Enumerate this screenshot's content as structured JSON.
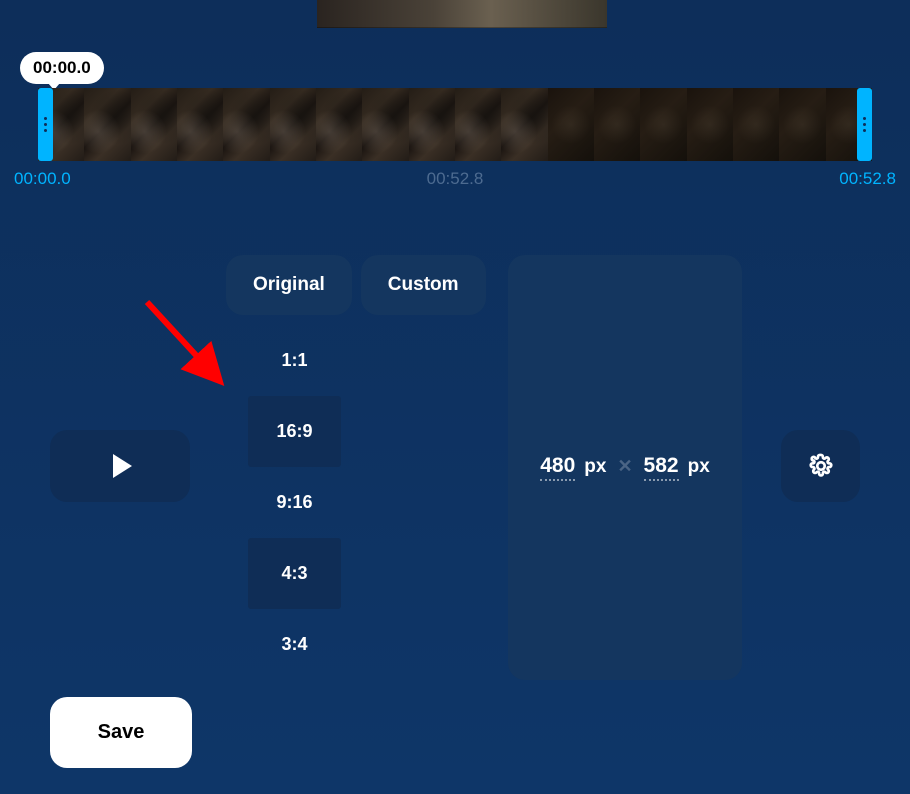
{
  "timeline": {
    "playhead_label": "00:00.0",
    "start_label": "00:00.0",
    "mid_label": "00:52.8",
    "end_label": "00:52.8"
  },
  "tabs": {
    "original": "Original",
    "custom": "Custom"
  },
  "ratios": [
    "1:1",
    "16:9",
    "9:16",
    "4:3",
    "3:4"
  ],
  "dimensions": {
    "width": "480",
    "height": "582",
    "unit": "px",
    "separator": "✕"
  },
  "buttons": {
    "save": "Save"
  },
  "icons": {
    "play": "play-icon",
    "settings": "gear-icon"
  }
}
